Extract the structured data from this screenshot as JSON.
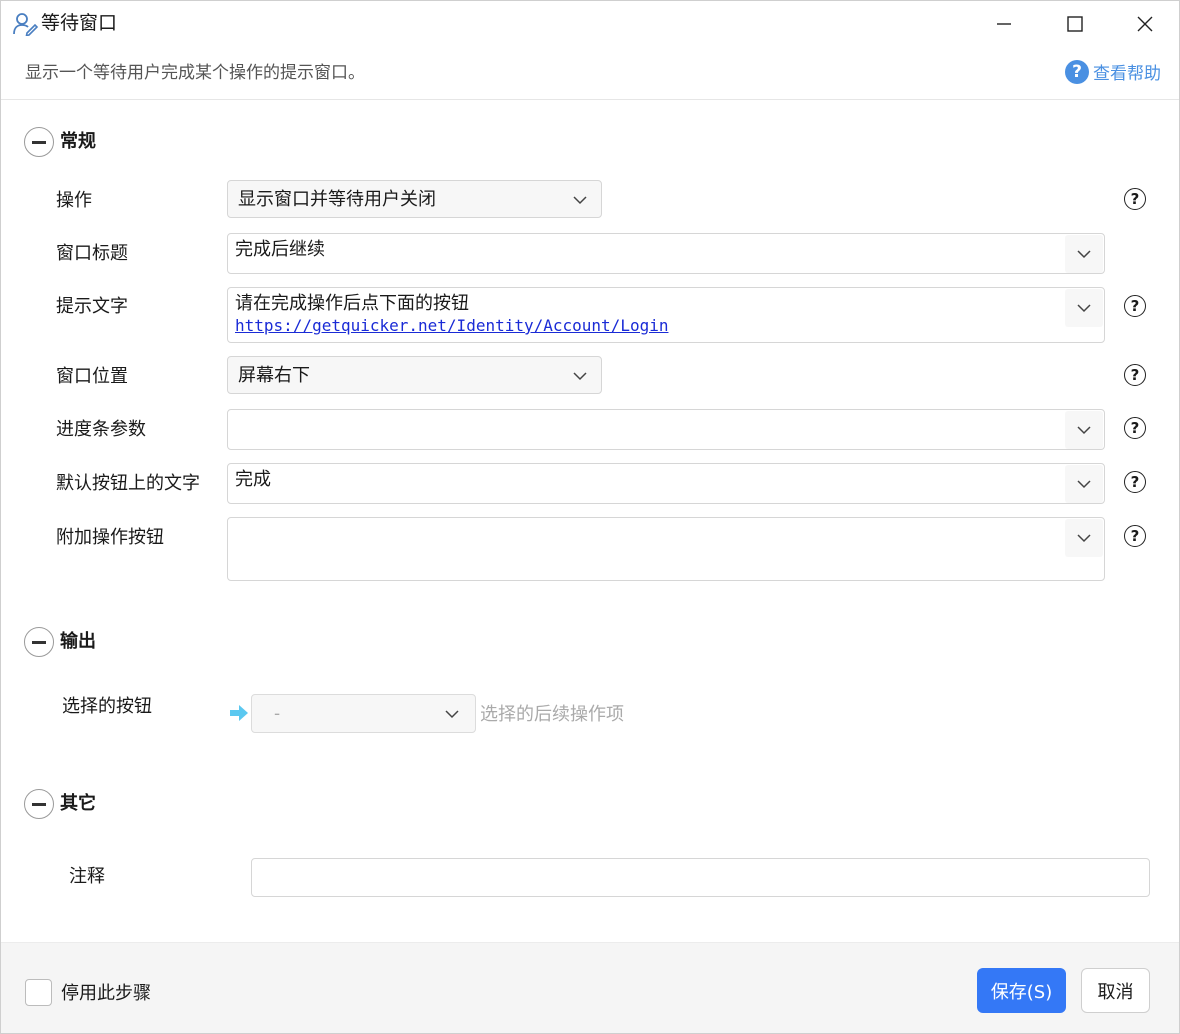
{
  "window": {
    "title": "等待窗口",
    "description": "显示一个等待用户完成某个操作的提示窗口。",
    "help_label": "查看帮助"
  },
  "sections": {
    "general": "常规",
    "output": "输出",
    "other": "其它"
  },
  "fields": {
    "operation": {
      "label": "操作",
      "value": "显示窗口并等待用户关闭"
    },
    "window_title": {
      "label": "窗口标题",
      "value": "完成后继续"
    },
    "prompt_text": {
      "label": "提示文字",
      "value": "请在完成操作后点下面的按钮",
      "link": "https://getquicker.net/Identity/Account/Login"
    },
    "window_position": {
      "label": "窗口位置",
      "value": "屏幕右下"
    },
    "progress_params": {
      "label": "进度条参数",
      "value": ""
    },
    "default_button_text": {
      "label": "默认按钮上的文字",
      "value": "完成"
    },
    "extra_buttons": {
      "label": "附加操作按钮",
      "value": ""
    }
  },
  "output": {
    "selected_button_label": "选择的按钮",
    "selected_value": "-",
    "hint": "选择的后续操作项"
  },
  "other": {
    "comment_label": "注释",
    "comment_value": ""
  },
  "footer": {
    "disable_step_label": "停用此步骤",
    "save_label": "保存(S)",
    "cancel_label": "取消"
  },
  "icons": {
    "help": "?",
    "field_help": "?"
  },
  "colors": {
    "accent": "#3478f6",
    "help_link": "#4a90e2",
    "url_link": "#1a2bd6",
    "arrow": "#5bc8f0"
  }
}
